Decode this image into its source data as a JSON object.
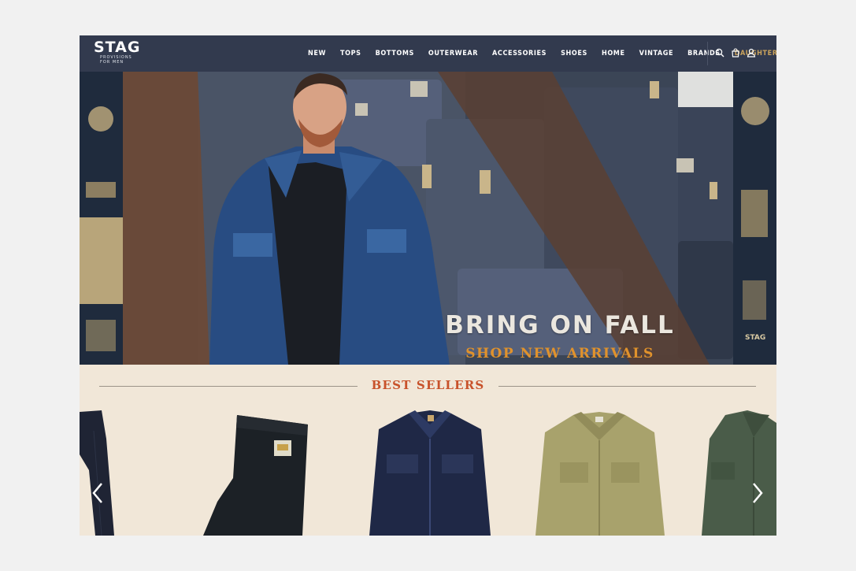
{
  "header": {
    "logo": {
      "word": "STAG",
      "tagline": "PROVISIONS FOR MEN"
    },
    "menu": [
      "NEW",
      "TOPS",
      "BOTTOMS",
      "OUTERWEAR",
      "ACCESSORIES",
      "SHOES",
      "HOME",
      "VINTAGE",
      "BRANDS",
      "DAUGHTERS"
    ],
    "accent_item": "DAUGHTERS",
    "icons": [
      "search-icon",
      "bag-icon",
      "user-icon"
    ]
  },
  "hero": {
    "headline": "BRING ON FALL",
    "cta": "SHOP NEW ARRIVALS",
    "mural_text": [
      "STAG"
    ]
  },
  "best_sellers": {
    "title": "BEST SELLERS",
    "products": [
      {
        "name": "dark-denim-jeans"
      },
      {
        "name": "black-work-pants"
      },
      {
        "name": "denim-trucker-jacket"
      },
      {
        "name": "tan-canvas-jacket"
      },
      {
        "name": "green-work-jacket"
      }
    ],
    "nav_icons": [
      "chevron-left-icon",
      "chevron-right-icon"
    ]
  },
  "colors": {
    "nav_bg": "#323a4e",
    "accent": "#c9a25c",
    "cta": "#e0922c",
    "section_title": "#c8522b",
    "section_bg": "#f1e7d8"
  }
}
